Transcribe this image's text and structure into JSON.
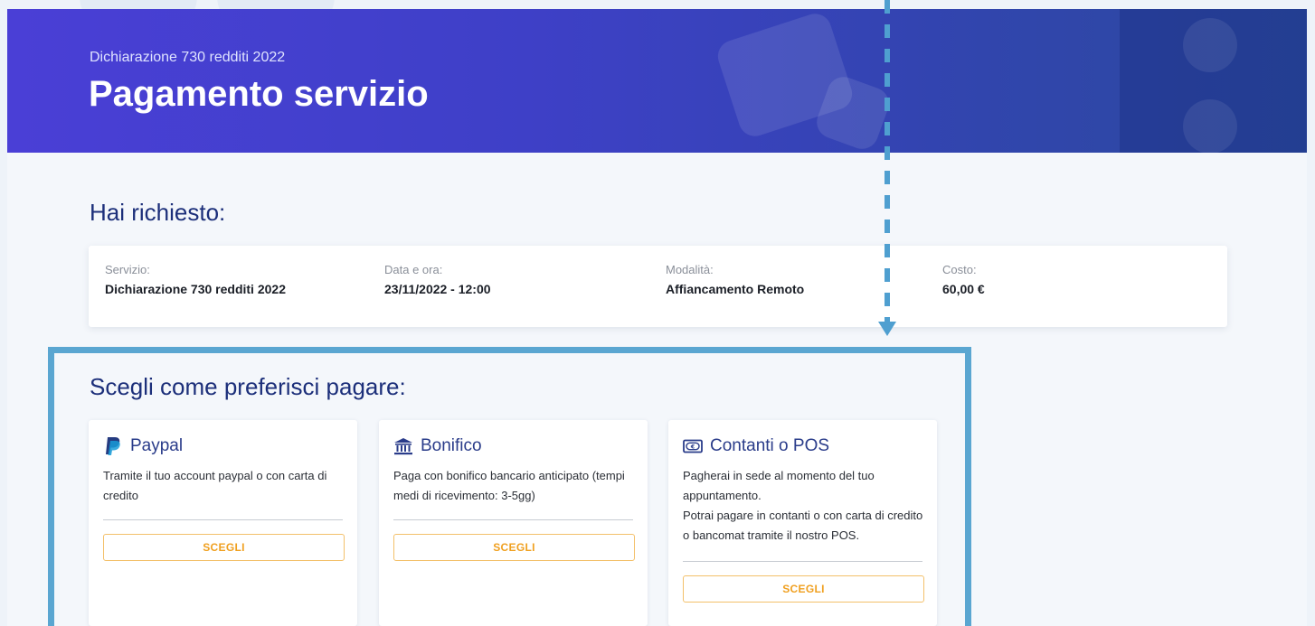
{
  "header": {
    "subtitle": "Dichiarazione 730 redditi 2022",
    "title": "Pagamento servizio"
  },
  "request": {
    "heading": "Hai richiesto:",
    "fields": [
      {
        "label": "Servizio:",
        "value": "Dichiarazione 730 redditi 2022"
      },
      {
        "label": "Data e ora:",
        "value": "23/11/2022 - 12:00"
      },
      {
        "label": "Modalità:",
        "value": "Affiancamento Remoto"
      },
      {
        "label": "Costo:",
        "value": "60,00 €"
      }
    ]
  },
  "payment": {
    "heading": "Scegli come preferisci pagare:",
    "options": [
      {
        "icon": "paypal-icon",
        "title": "Paypal",
        "description": "Tramite il tuo account paypal o con carta di credito",
        "button": "SCEGLI"
      },
      {
        "icon": "bank-icon",
        "title": "Bonifico",
        "description": "Paga con bonifico bancario anticipato (tempi medi di ricevimento: 3-5gg)",
        "button": "SCEGLI"
      },
      {
        "icon": "cash-icon",
        "title": "Contanti o POS",
        "description": "Pagherai in sede al momento del tuo appuntamento.",
        "description2": "Potrai pagare in contanti o con carta di credito o bancomat tramite il nostro POS.",
        "button": "SCEGLI"
      }
    ]
  },
  "colors": {
    "accent": "#f0a020",
    "title": "#1c2f7a",
    "highlight": "#5aa6d1"
  }
}
